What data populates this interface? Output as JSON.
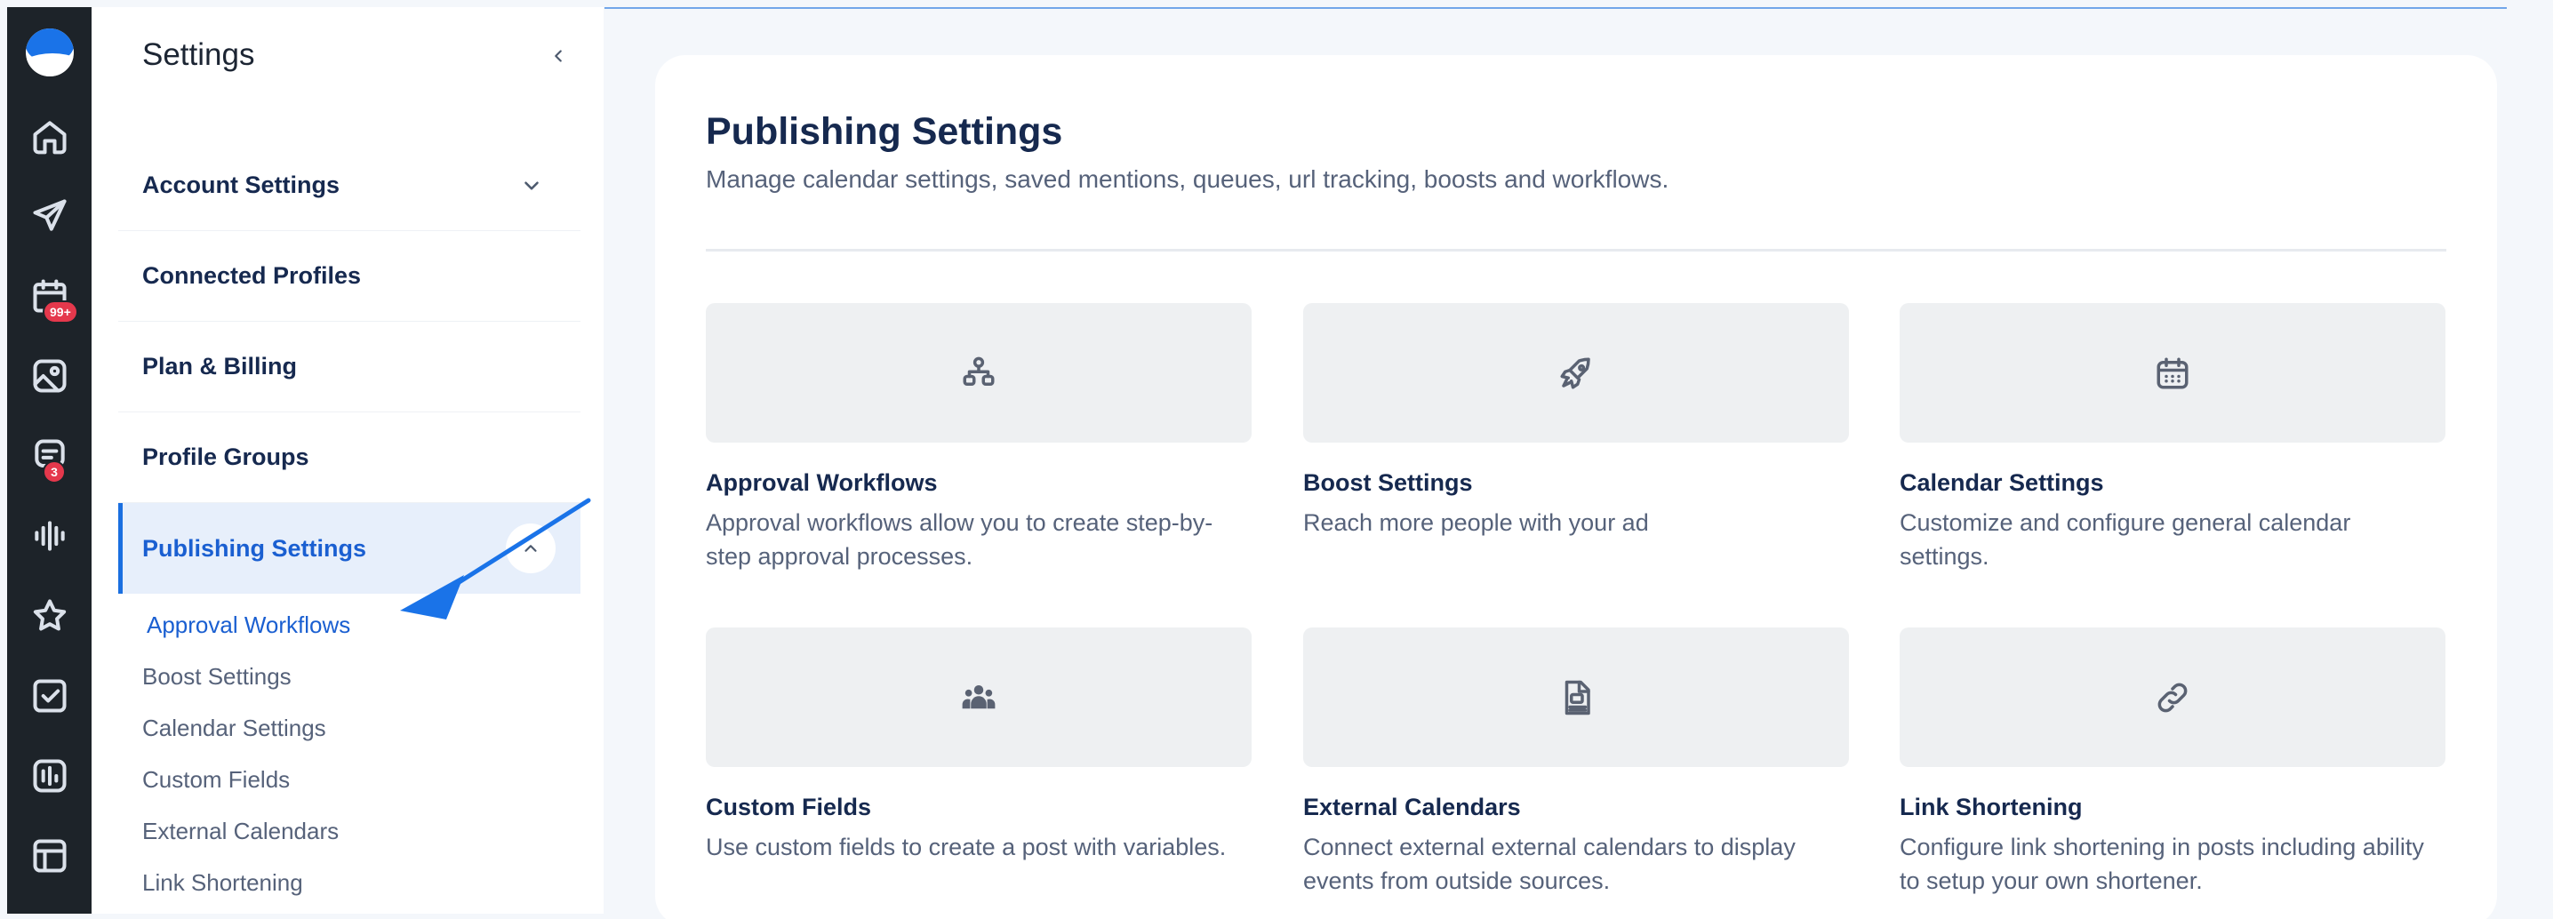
{
  "sidebar": {
    "title": "Settings",
    "nav": [
      {
        "label": "Account Settings"
      },
      {
        "label": "Connected Profiles"
      },
      {
        "label": "Plan & Billing"
      },
      {
        "label": "Profile Groups"
      },
      {
        "label": "Publishing Settings"
      }
    ],
    "subnav": [
      {
        "label": "Approval Workflows"
      },
      {
        "label": "Boost Settings"
      },
      {
        "label": "Calendar Settings"
      },
      {
        "label": "Custom Fields"
      },
      {
        "label": "External Calendars"
      },
      {
        "label": "Link Shortening"
      }
    ]
  },
  "rail": {
    "badges": {
      "calendar": "99+",
      "inbox": "3"
    }
  },
  "main": {
    "title": "Publishing Settings",
    "description": "Manage calendar settings, saved mentions, queues, url tracking, boosts and workflows.",
    "tiles": [
      {
        "title": "Approval Workflows",
        "desc": "Approval workflows allow you to create step-by-step approval processes.",
        "icon": "hierarchy-icon"
      },
      {
        "title": "Boost Settings",
        "desc": "Reach more people with your ad",
        "icon": "rocket-icon"
      },
      {
        "title": "Calendar Settings",
        "desc": "Customize and configure general calendar settings.",
        "icon": "calendar-icon"
      },
      {
        "title": "Custom Fields",
        "desc": "Use custom fields to create a post with variables.",
        "icon": "users-icon"
      },
      {
        "title": "External Calendars",
        "desc": "Connect external external calendars to display events from outside sources.",
        "icon": "ics-file-icon"
      },
      {
        "title": "Link Shortening",
        "desc": "Configure link shortening in posts including ability to setup your own shortener.",
        "icon": "link-icon"
      }
    ]
  }
}
